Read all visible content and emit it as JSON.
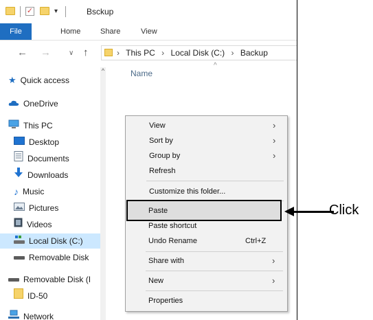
{
  "window": {
    "title": "Bsckup",
    "quick_access_glyph": "▾"
  },
  "ribbon": {
    "tabs": [
      "File",
      "Home",
      "Share",
      "View"
    ]
  },
  "address": {
    "back_glyph": "←",
    "forward_glyph": "→",
    "recent_glyph": "∨",
    "up_glyph": "↑",
    "crumbs": [
      "This PC",
      "Local Disk (C:)",
      "Backup"
    ],
    "separator": "›"
  },
  "nav": {
    "items": [
      {
        "label": "Quick access",
        "icon": "star-icon"
      },
      {
        "label": "OneDrive",
        "icon": "cloud-icon"
      },
      {
        "label": "This PC",
        "icon": "computer-icon"
      },
      {
        "label": "Desktop",
        "icon": "desktop-icon"
      },
      {
        "label": "Documents",
        "icon": "documents-icon"
      },
      {
        "label": "Downloads",
        "icon": "download-arrow-icon"
      },
      {
        "label": "Music",
        "icon": "music-note-icon"
      },
      {
        "label": "Pictures",
        "icon": "pictures-icon"
      },
      {
        "label": "Videos",
        "icon": "videos-icon"
      },
      {
        "label": "Local Disk (C:)",
        "icon": "drive-icon"
      },
      {
        "label": "Removable Disk",
        "icon": "removable-drive-icon"
      },
      {
        "label": "Removable Disk (I",
        "icon": "removable-drive-icon"
      },
      {
        "label": "ID-50",
        "icon": "folder-icon"
      },
      {
        "label": "Network",
        "icon": "network-icon"
      }
    ]
  },
  "content": {
    "column_name": "Name",
    "sort_glyph": "^"
  },
  "context_menu": {
    "items": [
      {
        "label": "View",
        "submenu": true
      },
      {
        "label": "Sort by",
        "submenu": true
      },
      {
        "label": "Group by",
        "submenu": true
      },
      {
        "label": "Refresh"
      },
      {
        "label": "Customize this folder..."
      },
      {
        "label": "Paste"
      },
      {
        "label": "Paste shortcut"
      },
      {
        "label": "Undo Rename",
        "shortcut": "Ctrl+Z"
      },
      {
        "label": "Share with",
        "submenu": true
      },
      {
        "label": "New",
        "submenu": true
      },
      {
        "label": "Properties"
      }
    ],
    "submenu_glyph": "›"
  },
  "annotation": {
    "label": "Click"
  },
  "colors": {
    "file_tab": "#1f6ec1",
    "selection": "#cce8ff",
    "folder": "#f6d36b"
  }
}
